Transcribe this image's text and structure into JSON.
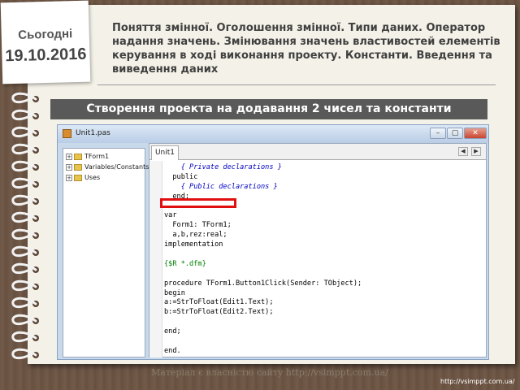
{
  "date_card": {
    "today_label": "Сьогодні",
    "date": "19.10.2016"
  },
  "title_lines": [
    "Поняття змінної. Оголошення змінної. Типи даних. Оператор",
    "надання значень. Змінювання значень властивостей елементів",
    "керування в ході виконання проекту. Константи. Введення та",
    "виведення даних"
  ],
  "banner": "Створення проекта на додавання 2 чисел та константи",
  "ide": {
    "window_title": "Unit1.pas",
    "window_buttons": {
      "minimize": "–",
      "maximize": "▢",
      "close": "✕"
    },
    "tree": [
      {
        "label": "TForm1",
        "expander": "+",
        "icon": "folder-icon"
      },
      {
        "label": "Variables/Constants",
        "expander": "+",
        "icon": "folder-icon"
      },
      {
        "label": "Uses",
        "expander": "+",
        "icon": "folder-icon"
      }
    ],
    "tab_label": "Unit1",
    "tab_arrows": {
      "left": "◀",
      "right": "▶"
    },
    "code_lines": [
      "    { Private declarations }",
      "  public",
      "    { Public declarations }",
      "  end;",
      "",
      "var",
      "  Form1: TForm1;",
      "  a,b,rez:real;",
      "implementation",
      "",
      "{$R *.dfm}",
      "",
      "procedure TForm1.Button1Click(Sender: TObject);",
      "begin",
      "a:=StrToFloat(Edit1.Text);",
      "b:=StrToFloat(Edit2.Text);",
      "",
      "end;",
      "",
      "end."
    ]
  },
  "watermark": "Матеріал є власністю сайту http://vsimppt.com.ua/",
  "footer_url": "http://vsimppt.com.ua/",
  "colors": {
    "banner_bg": "#595959",
    "highlight_box": "#e01010",
    "comment": "#0000c0",
    "directive": "#008000"
  }
}
